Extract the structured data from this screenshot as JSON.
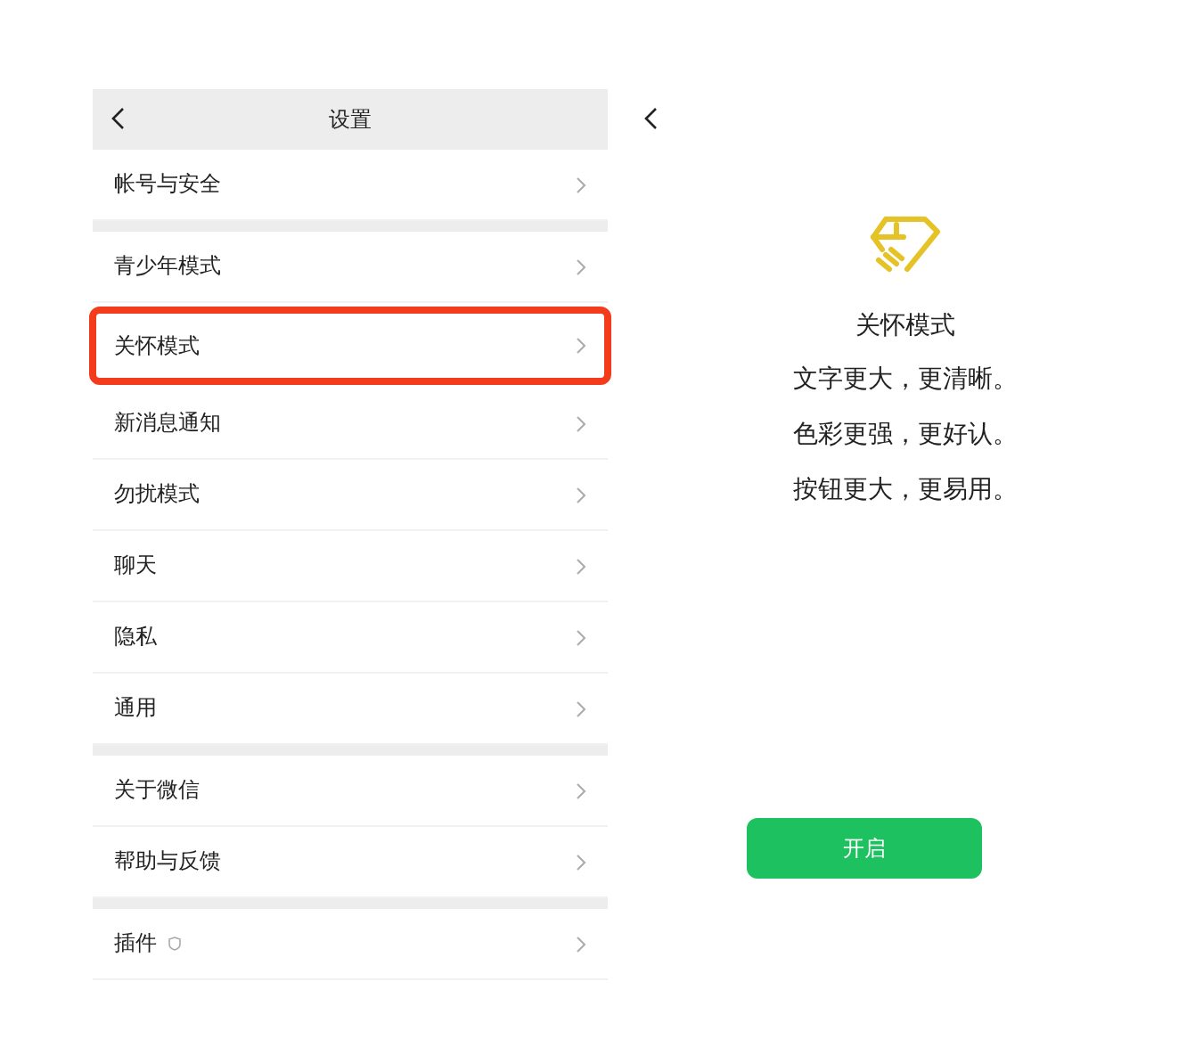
{
  "settings": {
    "title": "设置",
    "groups": [
      [
        {
          "label": "帐号与安全",
          "kind": "plain",
          "highlighted": false
        }
      ],
      [
        {
          "label": "青少年模式",
          "kind": "plain",
          "highlighted": false
        },
        {
          "label": "关怀模式",
          "kind": "plain",
          "highlighted": true
        },
        {
          "label": "新消息通知",
          "kind": "plain",
          "highlighted": false
        },
        {
          "label": "勿扰模式",
          "kind": "plain",
          "highlighted": false
        },
        {
          "label": "聊天",
          "kind": "plain",
          "highlighted": false
        },
        {
          "label": "隐私",
          "kind": "plain",
          "highlighted": false
        },
        {
          "label": "通用",
          "kind": "plain",
          "highlighted": false
        }
      ],
      [
        {
          "label": "关于微信",
          "kind": "plain",
          "highlighted": false
        },
        {
          "label": "帮助与反馈",
          "kind": "plain",
          "highlighted": false
        }
      ],
      [
        {
          "label": "插件",
          "kind": "badge",
          "highlighted": false
        }
      ]
    ]
  },
  "care_mode": {
    "title": "关怀模式",
    "lines": [
      "文字更大，更清晰。",
      "色彩更强，更好认。",
      "按钮更大，更易用。"
    ],
    "button": "开启"
  }
}
